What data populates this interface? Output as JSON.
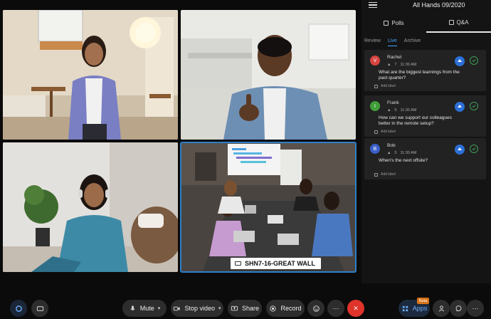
{
  "panel": {
    "title": "All Hands 09/2020",
    "tabs": [
      {
        "label": "Polls",
        "icon": "poll-icon"
      },
      {
        "label": "Q&A",
        "icon": "qa-icon"
      }
    ],
    "subtabs": [
      "Review",
      "Live",
      "Archive"
    ]
  },
  "questions": [
    {
      "name": "Rachel",
      "initial": "V",
      "avatar_color": "#d64541",
      "votes": "7",
      "time": "11:30 AM",
      "text": "What are the biggest learnings from the past quarter?",
      "add_label": "Add label"
    },
    {
      "name": "Frank",
      "initial": "I",
      "avatar_color": "#3f9e3a",
      "votes": "5",
      "time": "11:30 AM",
      "text": "How can we support our colleagues better in the remote setup?",
      "add_label": "Add label"
    },
    {
      "name": "Bob",
      "initial": "B",
      "avatar_color": "#3b5fc9",
      "votes": "5",
      "time": "11:30 AM",
      "text": "When's the next offsite?",
      "add_label": "Add label"
    }
  ],
  "room_label": "SHN7-16-GREAT WALL",
  "controls": {
    "mute": "Mute",
    "stop_video": "Stop video",
    "share": "Share",
    "record": "Record",
    "apps": "Apps",
    "beta": "Beta"
  },
  "colors": {
    "accent": "#2c6fd6",
    "end_call": "#e0332a",
    "active_tile_border": "#2e7fc7"
  }
}
